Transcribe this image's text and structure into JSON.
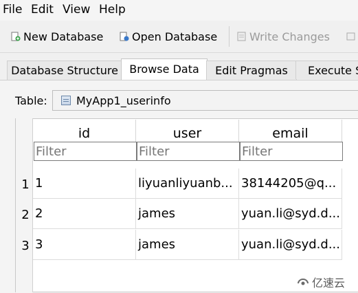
{
  "menu": [
    "File",
    "Edit",
    "View",
    "Help"
  ],
  "toolbar": {
    "new_database": "New Database",
    "open_database": "Open Database",
    "write_changes": "Write Changes"
  },
  "tabs": [
    {
      "label": "Database Structure",
      "active": false
    },
    {
      "label": "Browse Data",
      "active": true
    },
    {
      "label": "Edit Pragmas",
      "active": false
    },
    {
      "label": "Execute SQL",
      "active": false
    }
  ],
  "table_selector": {
    "label": "Table:",
    "selected": "MyApp1_userinfo"
  },
  "grid": {
    "columns": [
      "id",
      "user",
      "email"
    ],
    "filter_placeholder": "Filter",
    "rows": [
      {
        "num": "1",
        "id": "1",
        "user": "liyuanliyuanb...",
        "email": "38144205@q..."
      },
      {
        "num": "2",
        "id": "2",
        "user": "james",
        "email": "yuan.li@syd.d..."
      },
      {
        "num": "3",
        "id": "3",
        "user": "james",
        "email": "yuan.li@syd.d..."
      }
    ]
  },
  "watermark": "亿速云"
}
